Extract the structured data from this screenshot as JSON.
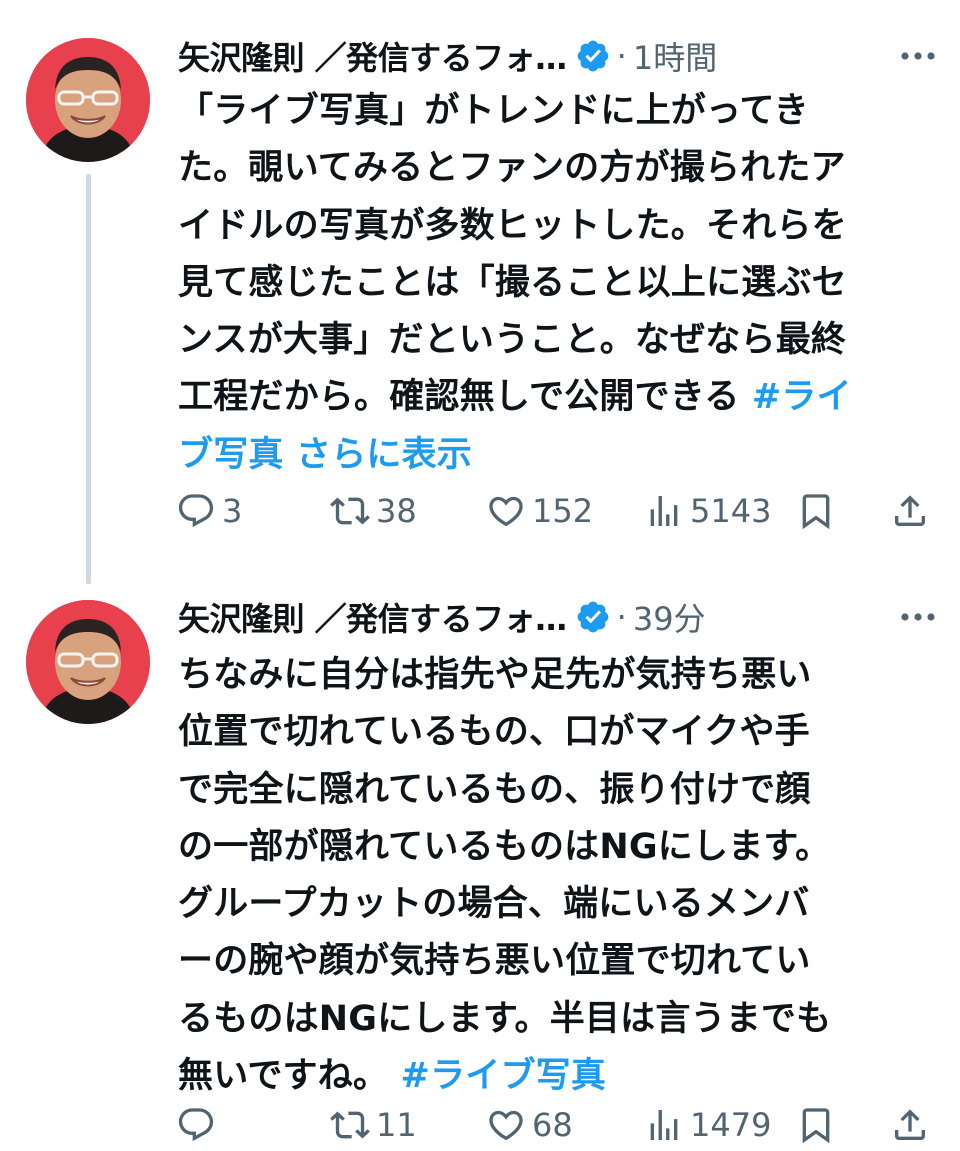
{
  "colors": {
    "link": "#1d9bf0",
    "muted": "#536471",
    "text": "#0f1419",
    "verified": "#1d9bf0",
    "avatar_bg": "#e8414d",
    "thread_line": "#cfd9de"
  },
  "tweets": [
    {
      "author": "矢沢隆則 ／発信するフォ…",
      "dot": "·",
      "time": "1時間",
      "lines": [
        {
          "text": "「ライブ写真」がトレンドに上がってき"
        },
        {
          "text": "た。覗いてみるとファンの方が撮られたア"
        },
        {
          "text": "イドルの写真が多数ヒットした。それらを"
        },
        {
          "text": "見て感じたことは「撮ること以上に選ぶセ"
        },
        {
          "text": "ンスが大事」だということ。なぜなら最終"
        },
        {
          "text": "工程だから。確認無しで公開できる",
          "link": "#ライ"
        },
        {
          "link": "ブ写真",
          "more": "さらに表示"
        }
      ],
      "replies": "3",
      "retweets": "38",
      "likes": "152",
      "views": "5143"
    },
    {
      "author": "矢沢隆則 ／発信するフォ…",
      "dot": "·",
      "time": "39分",
      "lines": [
        {
          "text": "ちなみに自分は指先や足先が気持ち悪い"
        },
        {
          "text": "位置で切れているもの、口がマイクや手"
        },
        {
          "text": "で完全に隠れているもの、振り付けで顔"
        },
        {
          "text": "の一部が隠れているものはNGにします。"
        },
        {
          "text": "グループカットの場合、端にいるメンバ"
        },
        {
          "text": "ーの腕や顔が気持ち悪い位置で切れてい"
        },
        {
          "text": "るものはNGにします。半目は言うまでも"
        },
        {
          "text": "無いですね。",
          "link": "#ライブ写真"
        }
      ],
      "replies": "",
      "retweets": "11",
      "likes": "68",
      "views": "1479"
    }
  ],
  "icons": {
    "reply": "reply-icon",
    "retweet": "retweet-icon",
    "like": "heart-icon",
    "views": "views-icon",
    "bookmark": "bookmark-icon",
    "share": "share-icon",
    "more": "more-icon",
    "verified": "verified-badge-icon"
  }
}
